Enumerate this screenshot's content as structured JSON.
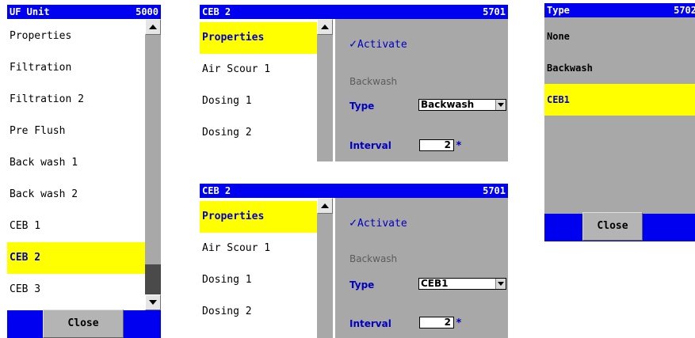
{
  "panel1": {
    "title": "UF Unit",
    "number": "5000",
    "items": [
      "Properties",
      "Filtration",
      "Filtration 2",
      "Pre Flush",
      "Back wash 1",
      "Back wash 2",
      "CEB 1",
      "CEB 2",
      "CEB 3"
    ],
    "selected_index": 7,
    "close_label": "Close"
  },
  "panel2": {
    "title": "CEB 2",
    "number": "5701",
    "items": [
      "Properties",
      "Air Scour 1",
      "Dosing 1",
      "Dosing 2"
    ],
    "selected_index": 0,
    "activate_label": "Activate",
    "section_label": "Backwash",
    "type_label": "Type",
    "type_value": "Backwash",
    "interval_label": "Interval",
    "interval_value": "2",
    "required_mark": "*"
  },
  "panel3": {
    "title": "CEB 2",
    "number": "5701",
    "items": [
      "Properties",
      "Air Scour 1",
      "Dosing 1",
      "Dosing 2"
    ],
    "selected_index": 0,
    "activate_label": "Activate",
    "section_label": "Backwash",
    "type_label": "Type",
    "type_value": "CEB1",
    "interval_label": "Interval",
    "interval_value": "2",
    "required_mark": "*"
  },
  "panel4": {
    "title": "Type",
    "number": "5702",
    "options": [
      "None",
      "Backwash",
      "CEB1"
    ],
    "selected_index": 2,
    "close_label": "Close"
  },
  "colors": {
    "title_bar": "#0000f0",
    "selection": "#ffff00",
    "panel_gray": "#a8a8a8",
    "label_blue": "#0000c0"
  }
}
